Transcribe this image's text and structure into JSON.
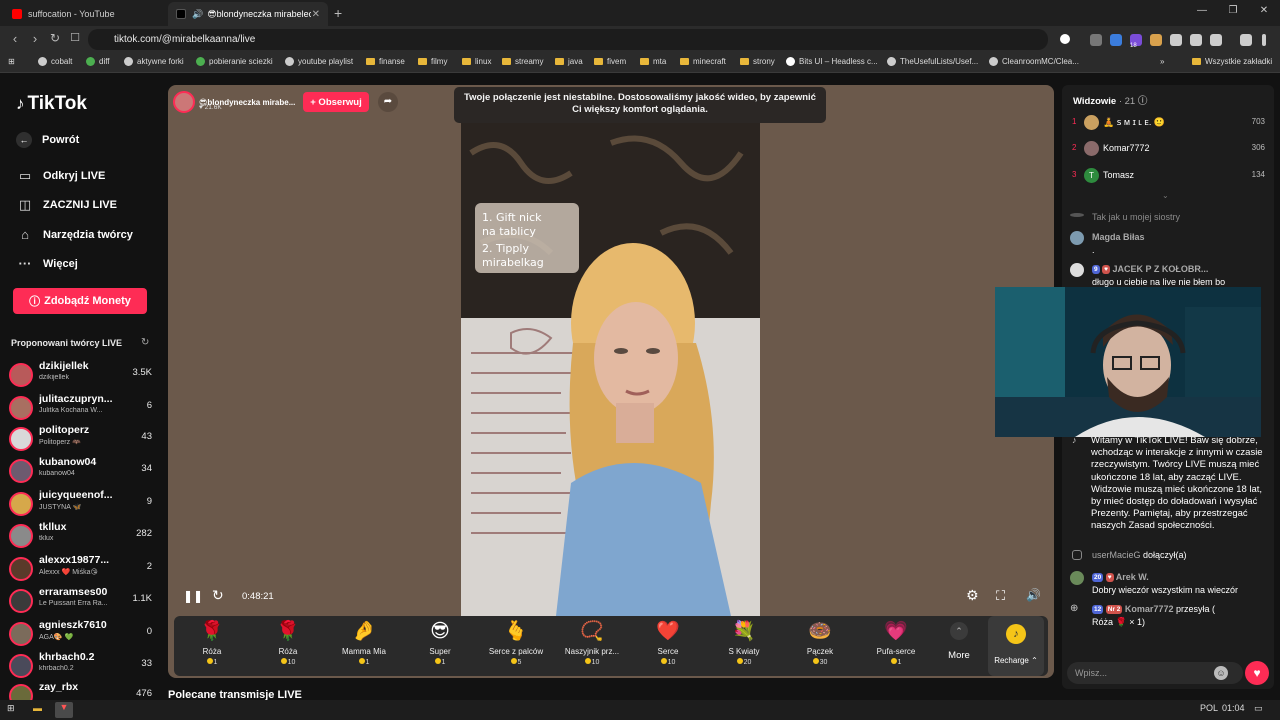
{
  "browser": {
    "tabs": [
      {
        "title": "suffocation - YouTube",
        "active": false
      },
      {
        "title": "😎blondyneczka mirabelecz",
        "active": true
      }
    ],
    "url": "tiktok.com/@mirabelkaanna/live",
    "bookmarks": [
      "cobalt",
      "diff",
      "aktywne forki",
      "pobieranie sciezki",
      "youtube playlist",
      "finanse",
      "filmy",
      "linux",
      "streamy",
      "java",
      "fivem",
      "mta",
      "minecraft",
      "strony",
      "Bits UI – Headless c...",
      "TheUsefulLists/Usef...",
      "CleanroomMC/Clea...",
      "Wszystkie zakładki"
    ],
    "extension_badge": "18"
  },
  "sidebar": {
    "logo": "TikTok",
    "nav": [
      {
        "label": "Powrót",
        "icon": "arrow-left-icon"
      },
      {
        "label": "Odkryj LIVE",
        "icon": "tv-icon"
      },
      {
        "label": "ZACZNIJ LIVE",
        "icon": "camera-icon"
      },
      {
        "label": "Narzędzia twórcy",
        "icon": "lightbulb-icon"
      },
      {
        "label": "Więcej",
        "icon": "dots-icon"
      }
    ],
    "coins_button": "Zdobądź Monety",
    "suggested_title": "Proponowani twórcy LIVE",
    "creators": [
      {
        "name": "dzikijellek",
        "sub": "dzikijellek",
        "count": "3.5K",
        "color": "#b85a5a"
      },
      {
        "name": "julitaczupryn...",
        "sub": "Julitka Kochana W...",
        "count": "6",
        "color": "#a96f61"
      },
      {
        "name": "politoperz",
        "sub": "Politoperz 🦇",
        "count": "43",
        "color": "#d9d9d9"
      },
      {
        "name": "kubanow04",
        "sub": "kubanow04",
        "count": "34",
        "color": "#6d5a6f"
      },
      {
        "name": "juicyqueenof...",
        "sub": "JUSTYNA 🦋",
        "count": "9",
        "color": "#d6a84a"
      },
      {
        "name": "tkllux",
        "sub": "tklux",
        "count": "282",
        "color": "#8a8a8a"
      },
      {
        "name": "alexxx19877...",
        "sub": "Alexxx ❤️ Miśka😘",
        "count": "2",
        "color": "#5a3a2a"
      },
      {
        "name": "erraramses00",
        "sub": "Le Puissant Erra Ra...",
        "count": "1.1K",
        "color": "#3a3a3a"
      },
      {
        "name": "agnieszk7610",
        "sub": "AGA🎨 💚",
        "count": "0",
        "color": "#7b6b5b"
      },
      {
        "name": "khrbach0.2",
        "sub": "khrbach0.2",
        "count": "33",
        "color": "#4a4a5a"
      },
      {
        "name": "zay_rbx",
        "sub": "",
        "count": "476",
        "color": "#6a6a3a"
      }
    ]
  },
  "player": {
    "host_name": "😎blondyneczka mirabe...",
    "host_likes": "♥ 21.6K",
    "follow": "+ Obserwuj",
    "notice": "Twoje połączenie jest niestabilne. Dostosowaliśmy jakość wideo, by zapewnić Ci większy komfort oglądania.",
    "time": "0:48:21",
    "sign_text": [
      "1. Gift nick",
      "na tablicy",
      "2. Tipply",
      "mirabelkag"
    ],
    "gifts": [
      {
        "name": "Róża",
        "price": "1",
        "icon": "🌹"
      },
      {
        "name": "Róża",
        "price": "10",
        "icon": "🌹"
      },
      {
        "name": "Mamma Mia",
        "price": "1",
        "icon": "🤌"
      },
      {
        "name": "Super",
        "price": "1",
        "icon": "😎"
      },
      {
        "name": "Serce z palców",
        "price": "5",
        "icon": "🫰"
      },
      {
        "name": "Naszyjnik prz...",
        "price": "10",
        "icon": "📿"
      },
      {
        "name": "Serce",
        "price": "10",
        "icon": "❤️"
      },
      {
        "name": "S Kwiaty",
        "price": "20",
        "icon": "💐"
      },
      {
        "name": "Pączek",
        "price": "30",
        "icon": "🍩"
      },
      {
        "name": "Pufa-serce",
        "price": "1",
        "icon": "💗"
      }
    ],
    "more": "More",
    "recharge": "Recharge ⌃"
  },
  "recommended_title": "Polecane transmisje LIVE",
  "right_panel": {
    "viewers_title": "Widzowie",
    "viewers_count": "· 21",
    "viewers": [
      {
        "rank": "1",
        "name": "🧘 ꜱ ᴍ ɪ ʟ ᴇ. 🙂",
        "score": "703",
        "color": "#caa060"
      },
      {
        "rank": "2",
        "name": "Komar7772",
        "score": "306",
        "color": "#8a6a6a"
      },
      {
        "rank": "3",
        "name": "Tomasz",
        "score": "134",
        "color": "#2e8b3e",
        "initial": "T"
      }
    ],
    "chat": [
      {
        "name": "Tak jak u mojej siostry",
        "text": ""
      },
      {
        "name": "Magda Biłas",
        "text": "."
      },
      {
        "name": "JACEK P Z KOŁOBR...",
        "badge": "9",
        "text": "długo u ciebie na live nie błem bo"
      }
    ],
    "welcome": "Witamy w TikTok LIVE! Baw się dobrze, wchodząc w interakcje z innymi w czasie rzeczywistym. Twórcy LIVE muszą mieć ukończone 18 lat, aby zacząć LIVE. Widzowie muszą mieć ukończone 18 lat, by mieć dostęp do doładowań i wysyłać Prezenty. Pamiętaj, aby przestrzegać naszych Zasad społeczności.",
    "joined_name": "userMacieG",
    "joined_text": "dołączył(a)",
    "msg1_badge": "20",
    "msg1_name": "Arek W.",
    "msg1_text": "Dobry wieczór wszystkim na wieczór",
    "msg2_badge": "12",
    "msg2_badge2": "Nr 2",
    "msg2_name": "Komar7772",
    "msg2_action": "przesyła (",
    "msg2_text": "Róża 🌹 × 1)",
    "input_placeholder": "Wpisz..."
  },
  "taskbar": {
    "lang": "POL",
    "time": "01:04"
  }
}
